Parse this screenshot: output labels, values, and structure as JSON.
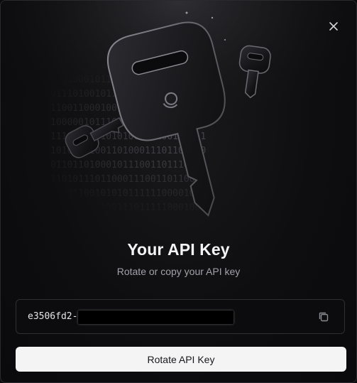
{
  "dialog": {
    "title": "Your API Key",
    "subtitle": "Rotate or copy your API key"
  },
  "api_key": {
    "visible_prefix": "e3506fd2-(",
    "masked": true
  },
  "actions": {
    "rotate_label": "Rotate API Key"
  },
  "hero": {
    "binary_rows": [
      "0000111011010101100000101001",
      "1011000101101011110001011010",
      "0111010010110010000111101100",
      "1100110001001110101110011010",
      "1000001011100010111100011011",
      "1110110001010100111100100011",
      "1010000100110100011101101000",
      "0110110100010111001101110110",
      "1101011101100011100110110000",
      "1000110010101011111100001011",
      "0111000101001110111110001000"
    ]
  },
  "icons": {
    "close": "close-icon",
    "copy": "copy-icon",
    "key_large": "key-icon",
    "logo": "brand-logo-icon"
  },
  "colors": {
    "background": "#0b0b0d",
    "title": "#f4f4f5",
    "subtitle": "#a1a1aa",
    "button_bg": "#f4f4f5",
    "button_text": "#18181b",
    "border": "#2e2e33"
  }
}
